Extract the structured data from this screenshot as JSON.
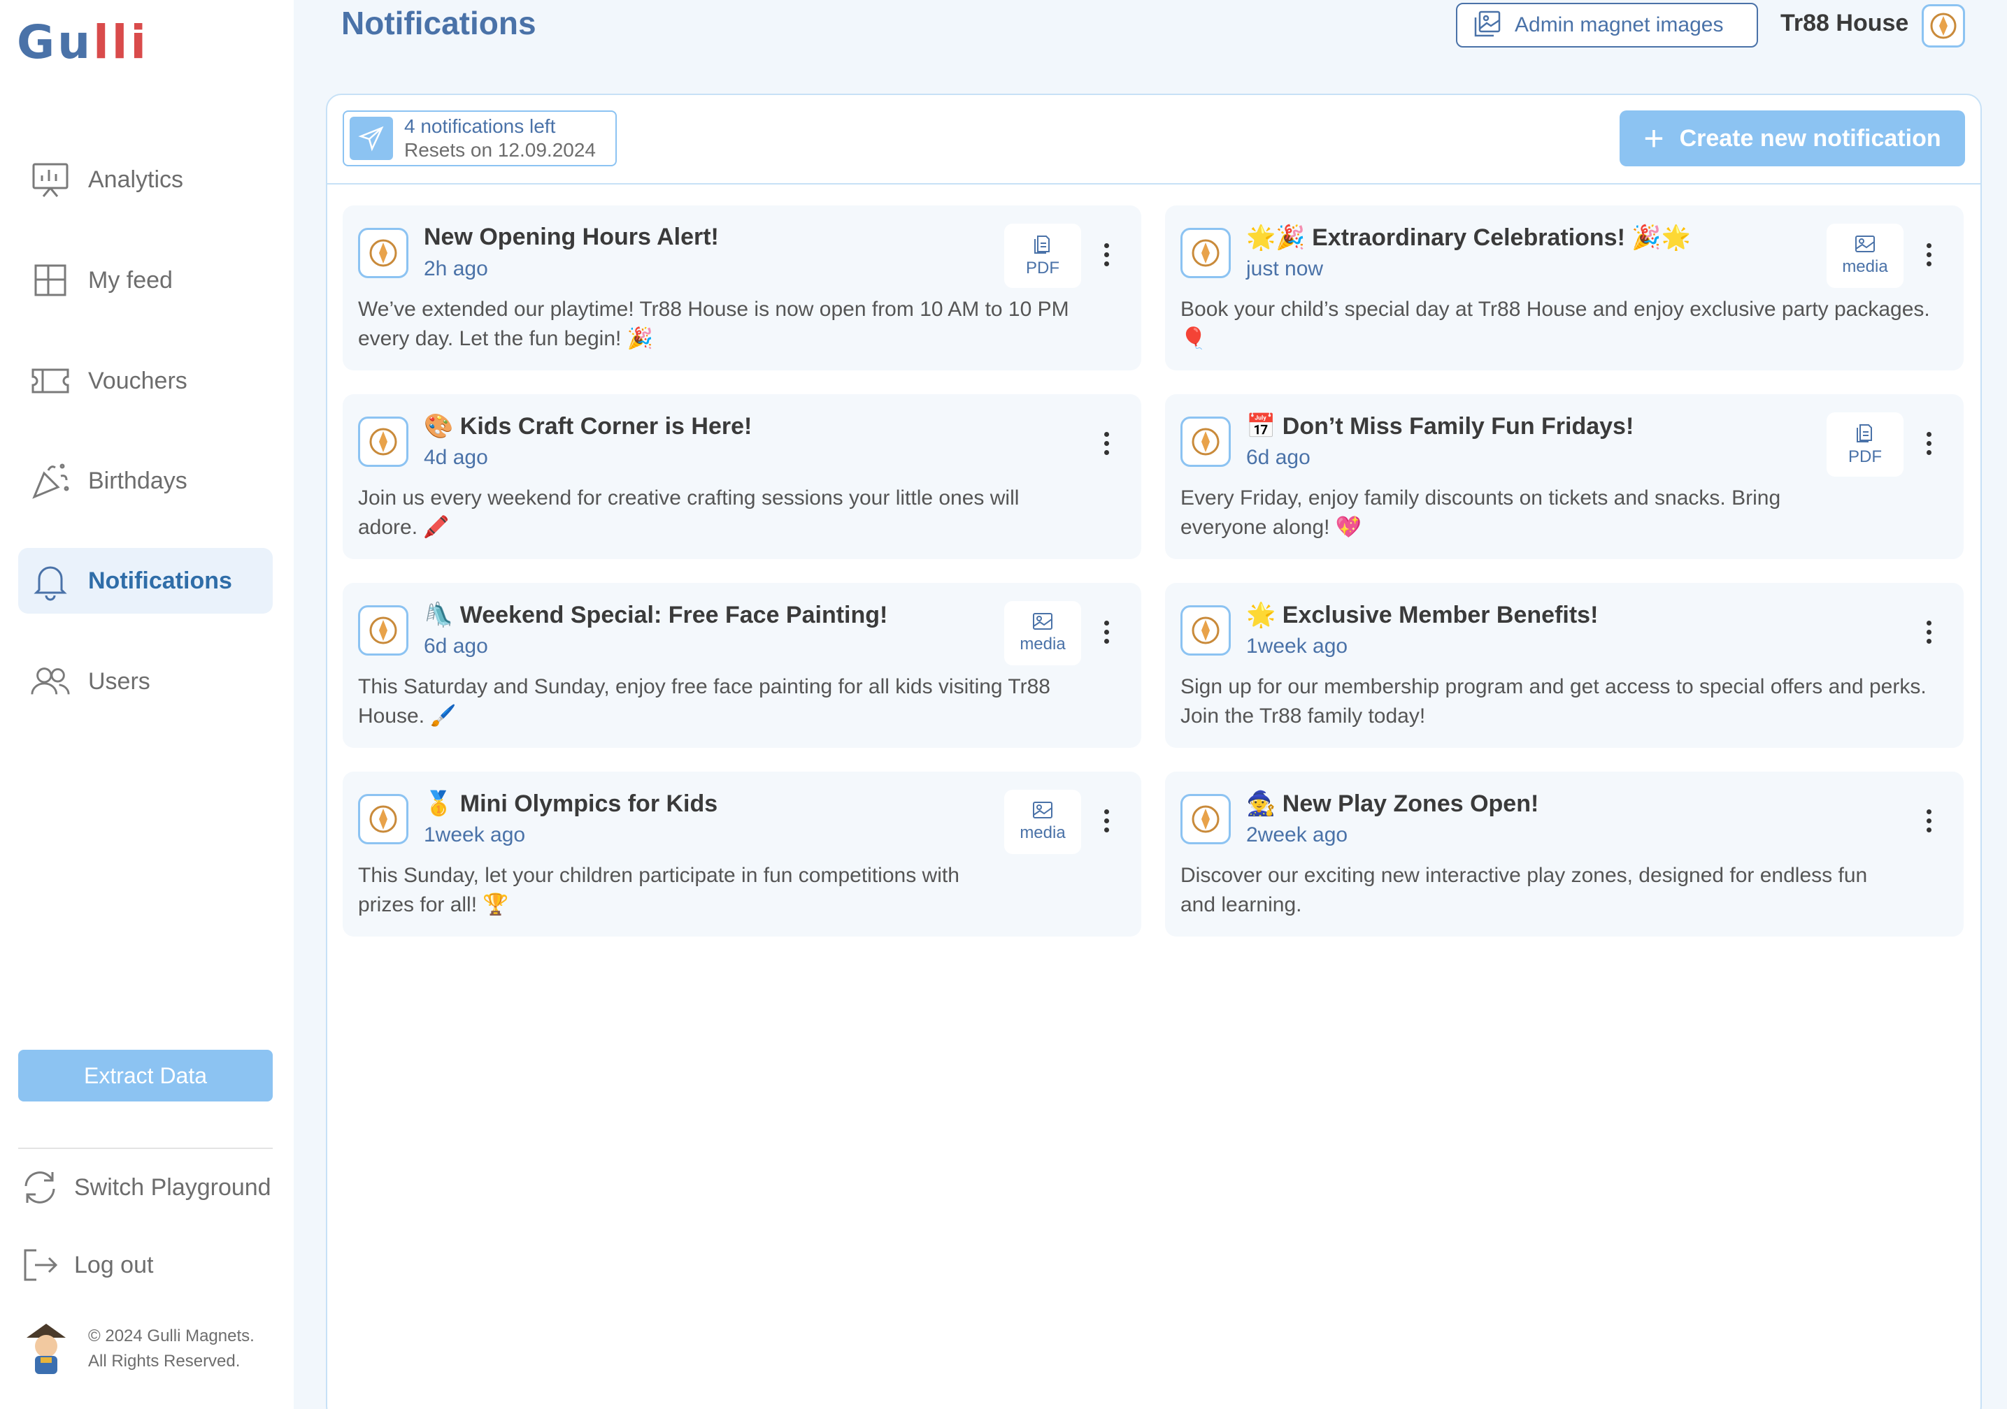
{
  "brand": {
    "logo_text": "Gu",
    "logo_dots": "lli"
  },
  "sidebar": {
    "items": [
      {
        "label": "Analytics"
      },
      {
        "label": "My feed"
      },
      {
        "label": "Vouchers"
      },
      {
        "label": "Birthdays"
      },
      {
        "label": "Notifications",
        "active": true
      },
      {
        "label": "Users"
      }
    ],
    "extract_label": "Extract Data",
    "switch_label": "Switch Playground",
    "logout_label": "Log out",
    "copyright_line1": "© 2024 Gulli Magnets.",
    "copyright_line2": "All Rights Reserved."
  },
  "header": {
    "title": "Notifications",
    "admin_button": "Admin magnet images",
    "house_name": "Tr88 House"
  },
  "panel": {
    "quota_count": "4 notifications left",
    "quota_reset": "Resets on 12.09.2024",
    "create_label": "Create new notification"
  },
  "notifications": [
    {
      "title": "New Opening Hours Alert!",
      "time": "2h ago",
      "body": "We’ve extended our playtime! Tr88 House is now open from 10 AM to 10 PM every day. Let the fun begin! 🎉",
      "attachment": "PDF"
    },
    {
      "title": "🌟🎉 Extraordinary Celebrations! 🎉🌟",
      "time": "just now",
      "body": "Book your child’s special day at Tr88 House and enjoy exclusive party packages. 🎈",
      "attachment": "media"
    },
    {
      "title": "🎨 Kids Craft Corner is Here!",
      "time": "4d ago",
      "body": "Join us every weekend for creative crafting sessions your little ones will adore. 🖍️",
      "attachment": ""
    },
    {
      "title": "📅 Don’t Miss Family Fun Fridays!",
      "time": "6d ago",
      "body": "Every Friday, enjoy family discounts on tickets and snacks. Bring everyone along! 💖",
      "attachment": "PDF"
    },
    {
      "title": "🛝 Weekend Special: Free Face Painting!",
      "time": "6d ago",
      "body": "This Saturday and Sunday, enjoy free face painting for all kids visiting Tr88 House. 🖌️",
      "attachment": "media"
    },
    {
      "title": "🌟 Exclusive Member Benefits!",
      "time": "1week ago",
      "body": "Sign up for our membership program and get access to special offers and perks. Join the Tr88 family today!",
      "attachment": ""
    },
    {
      "title": "🥇 Mini Olympics for Kids",
      "time": "1week ago",
      "body": "This Sunday, let your children participate in fun competitions with prizes for all! 🏆",
      "attachment": "media"
    },
    {
      "title": "🧙 New Play Zones Open!",
      "time": "2week ago",
      "body": "Discover our exciting new interactive play zones, designed for endless fun and learning.",
      "attachment": ""
    }
  ],
  "colors": {
    "accent": "#4a72a8",
    "button_light": "#8cc3f2",
    "card_bg": "#f4f8fc",
    "page_bg": "#f2f7fc"
  }
}
